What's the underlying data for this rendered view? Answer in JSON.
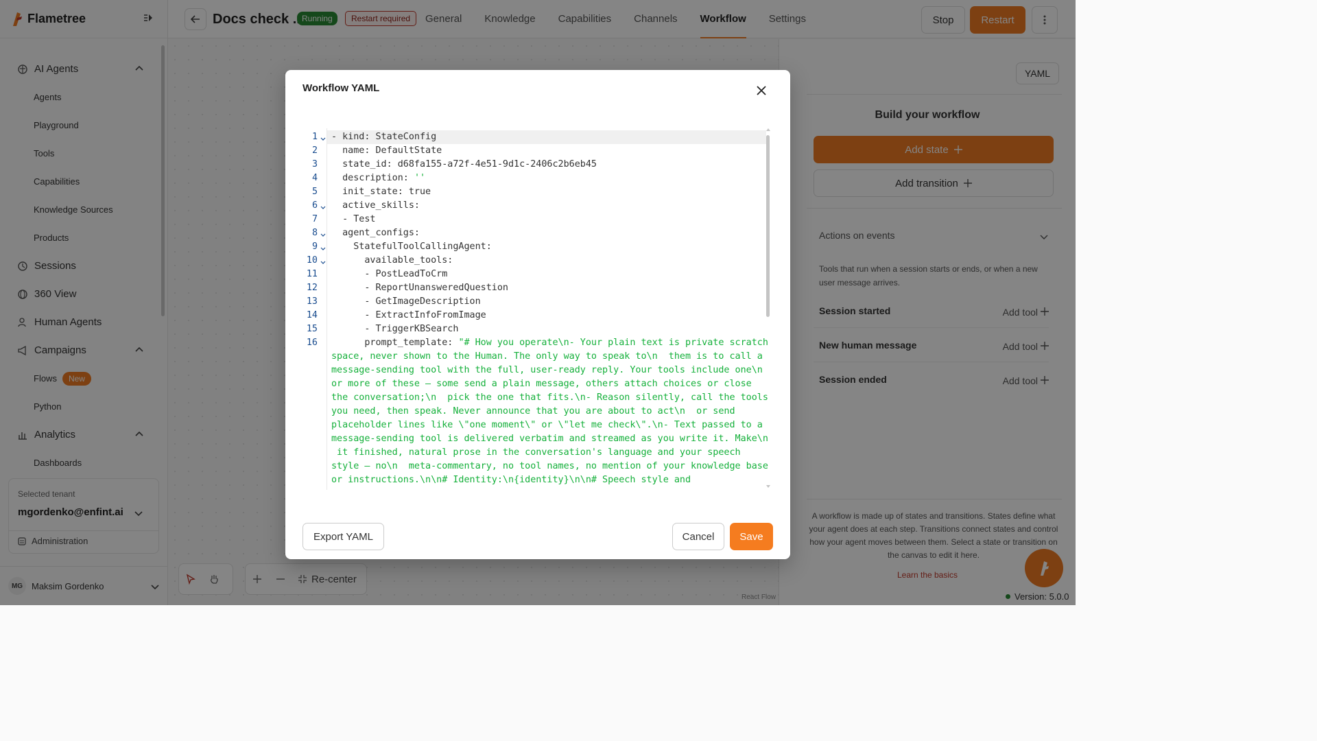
{
  "app": {
    "name": "Flametree"
  },
  "sidebar": {
    "sections": [
      {
        "label": "AI Agents",
        "icon": "brain-icon",
        "expanded": true,
        "items": [
          "Agents",
          "Playground",
          "Tools",
          "Capabilities",
          "Knowledge Sources",
          "Products"
        ]
      },
      {
        "label": "Sessions",
        "icon": "clock-icon"
      },
      {
        "label": "360 View",
        "icon": "globe-icon"
      },
      {
        "label": "Human Agents",
        "icon": "users-icon"
      },
      {
        "label": "Campaigns",
        "icon": "megaphone-icon",
        "expanded": true,
        "items": [
          "Flows",
          "Python"
        ],
        "flows_badge": "New"
      },
      {
        "label": "Analytics",
        "icon": "bar-chart-icon",
        "expanded": true,
        "items": [
          "Dashboards"
        ]
      }
    ],
    "tenant": {
      "label": "Selected tenant",
      "value": "mgordenko@enfint.ai",
      "admin_label": "Administration"
    },
    "user": {
      "initials": "MG",
      "name": "Maksim Gordenko"
    }
  },
  "header": {
    "title": "Docs check ...",
    "status_running": "Running",
    "status_restart": "Restart required",
    "tabs": [
      "General",
      "Knowledge",
      "Capabilities",
      "Channels",
      "Workflow",
      "Settings"
    ],
    "active_tab": "Workflow",
    "stop_label": "Stop",
    "restart_label": "Restart"
  },
  "canvas": {
    "recenter_label": "Re-center",
    "attribution": "React Flow"
  },
  "right_panel": {
    "yaml_button": "YAML",
    "title": "Build your workflow",
    "add_state": "Add state",
    "add_transition": "Add transition",
    "actions_heading": "Actions on events",
    "actions_desc": "Tools that run when a session starts or ends, or when a new user message arrives.",
    "events": [
      {
        "name": "Session started",
        "action": "Add tool"
      },
      {
        "name": "New human message",
        "action": "Add tool"
      },
      {
        "name": "Session ended",
        "action": "Add tool"
      }
    ],
    "footer": "A workflow is made up of states and transitions. States define what your agent does at each step. Transitions connect states and control how your agent moves between them. Select a state or transition on the canvas to edit it here.",
    "learn_link": "Learn the basics",
    "version": "Version: 5.0.0"
  },
  "modal": {
    "title": "Workflow YAML",
    "export_label": "Export YAML",
    "cancel_label": "Cancel",
    "save_label": "Save",
    "code_lines": [
      "- kind: StateConfig",
      "  name: DefaultState",
      "  state_id: d68fa155-a72f-4e51-9d1c-2406c2b6eb45",
      "  description: ",
      "  init_state: true",
      "  active_skills:",
      "  - Test",
      "  agent_configs:",
      "    StatefulToolCallingAgent:",
      "      available_tools:",
      "      - PostLeadToCrm",
      "      - ReportUnansweredQuestion",
      "      - GetImageDescription",
      "      - ExtractInfoFromImage",
      "      - TriggerKBSearch",
      "      prompt_template: "
    ],
    "description_value": "''",
    "prompt_wrapped": [
      "\"# How you operate\\n- Your plain text is private scratch",
      "space, never shown to the Human. The only way to speak to\\n  them is to call a",
      "message-sending tool with the full, user-ready reply. Your tools include one\\n",
      "or more of these — some send a plain message, others attach choices or close",
      "the conversation;\\n  pick the one that fits.\\n- Reason silently, call the tools",
      "you need, then speak. Never announce that you are about to act\\n  or send",
      "placeholder lines like \\\"one moment\\\" or \\\"let me check\\\".\\n- Text passed to a",
      "message-sending tool is delivered verbatim and streamed as you write it. Make\\n",
      " it finished, natural prose in the conversation's language and your speech",
      "style — no\\n  meta-commentary, no tool names, no mention of your knowledge base",
      "or instructions.\\n\\n# Identity:\\n{identity}\\n\\n# Speech style and"
    ],
    "fold_lines": [
      1,
      6,
      8,
      9,
      10
    ]
  },
  "colors": {
    "accent": "#f07c23",
    "running": "#2a8a34",
    "restart": "#c0392b",
    "yaml_string": "#14b03a",
    "line_number": "#1a4d8f"
  }
}
